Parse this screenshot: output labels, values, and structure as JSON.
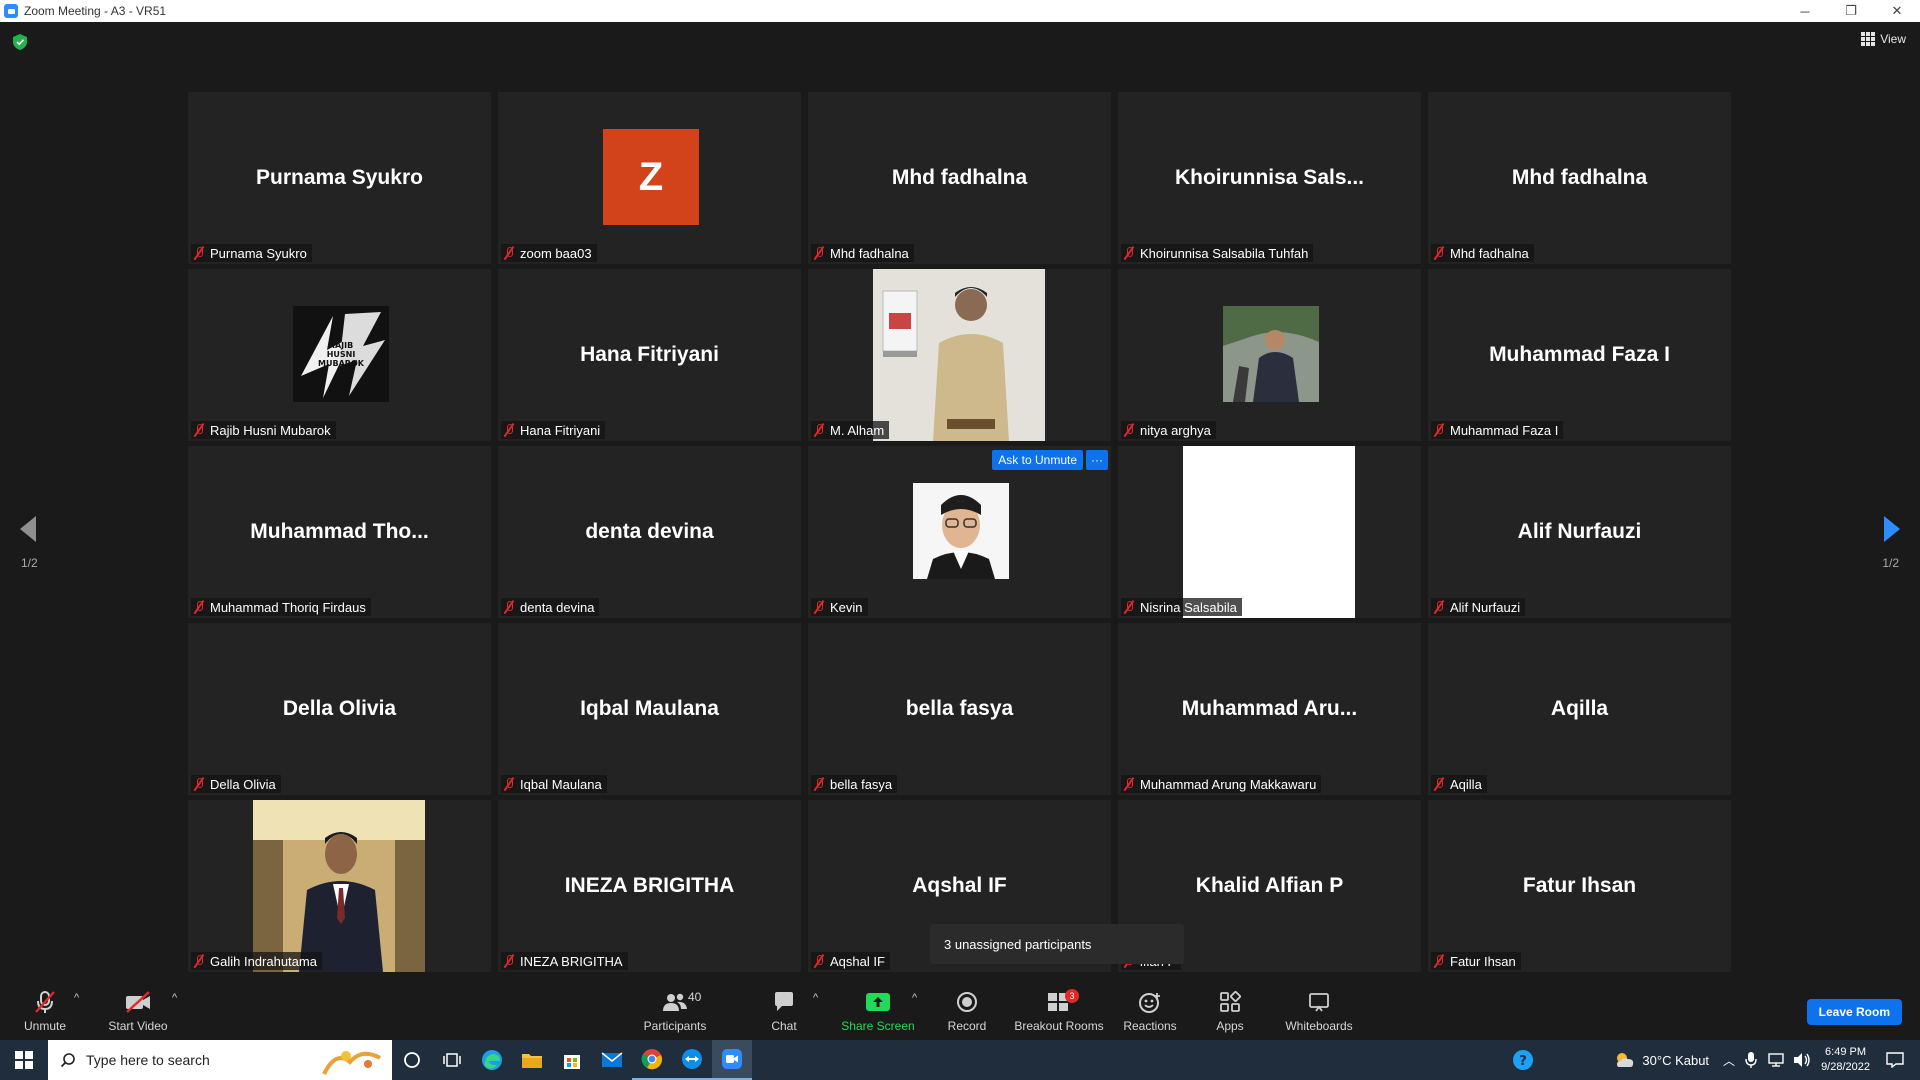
{
  "window": {
    "title": "Zoom Meeting - A3 - VR51",
    "minimize": "─",
    "restore": "❐",
    "close": "✕"
  },
  "top": {
    "view_label": "View"
  },
  "pager": {
    "left_page": "1/2",
    "right_page": "1/2"
  },
  "tiles": [
    {
      "big": "Purnama Syukro",
      "label": "Purnama Syukro"
    },
    {
      "big": "",
      "avatar_letter": "Z",
      "label": "zoom baa03"
    },
    {
      "big": "Mhd fadhalna",
      "label": "Mhd fadhalna"
    },
    {
      "big": "Khoirunnisa  Sals...",
      "label": "Khoirunnisa Salsabila Tuhfah"
    },
    {
      "big": "Mhd fadhalna",
      "label": "Mhd fadhalna"
    },
    {
      "big": "",
      "image_text": "RAJIB HUSNI MUBAROK",
      "label": "Rajib Husni Mubarok"
    },
    {
      "big": "Hana Fitriyani",
      "label": "Hana Fitriyani"
    },
    {
      "big": "",
      "label": "M. Alham"
    },
    {
      "big": "",
      "label": "nitya arghya"
    },
    {
      "big": "Muhammad Faza I",
      "label": "Muhammad Faza I"
    },
    {
      "big": "Muhammad  Tho...",
      "label": "Muhammad Thoriq Firdaus"
    },
    {
      "big": "denta devina",
      "label": "denta devina"
    },
    {
      "big": "",
      "label": "Kevin",
      "ask_unmute": "Ask to Unmute",
      "more": "···"
    },
    {
      "big": "",
      "label": "Nisrina Salsabila"
    },
    {
      "big": "Alif Nurfauzi",
      "label": "Alif Nurfauzi"
    },
    {
      "big": "Della Olivia",
      "label": "Della Olivia"
    },
    {
      "big": "Iqbal Maulana",
      "label": "Iqbal Maulana"
    },
    {
      "big": "bella fasya",
      "label": "bella fasya"
    },
    {
      "big": "Muhammad  Aru...",
      "label": "Muhammad Arung Makkawaru"
    },
    {
      "big": "Aqilla",
      "label": "Aqilla"
    },
    {
      "big": "",
      "label": "Galih Indrahutama"
    },
    {
      "big": "INEZA BRIGITHA",
      "label": "INEZA BRIGITHA"
    },
    {
      "big": "Aqshal IF",
      "label": "Aqshal IF"
    },
    {
      "big": "Khalid Alfian P",
      "label": "lfian P"
    },
    {
      "big": "Fatur Ihsan",
      "label": "Fatur Ihsan"
    }
  ],
  "popup": {
    "text": "3 unassigned participants"
  },
  "toolbar": {
    "unmute": "Unmute",
    "start_video": "Start Video",
    "participants": "Participants",
    "participants_count": "40",
    "chat": "Chat",
    "share_screen": "Share Screen",
    "record": "Record",
    "breakout_rooms": "Breakout Rooms",
    "breakout_badge": "3",
    "reactions": "Reactions",
    "apps": "Apps",
    "whiteboards": "Whiteboards",
    "leave": "Leave Room"
  },
  "taskbar": {
    "search_placeholder": "Type here to search",
    "weather": "30°C  Kabut",
    "time": "6:49 PM",
    "date": "9/28/2022"
  },
  "colors": {
    "accent": "#0e72ed",
    "muted_red": "#e02828",
    "share_green": "#23d959",
    "avatar_orange": "#d2431b"
  }
}
